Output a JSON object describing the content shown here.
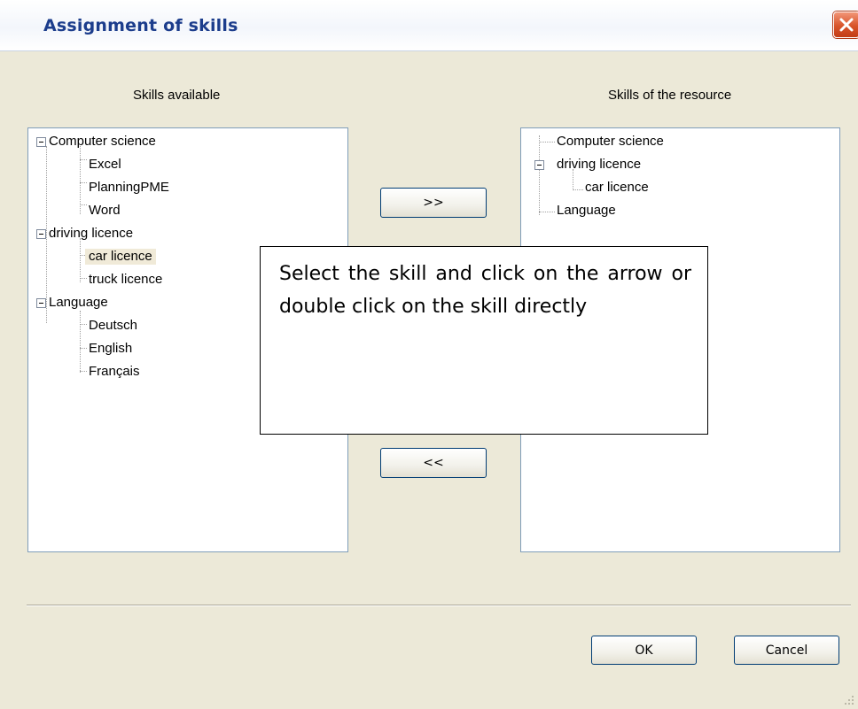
{
  "window": {
    "title": "Assignment of skills"
  },
  "left_panel": {
    "label": "Skills available",
    "tree": [
      {
        "label": "Computer science",
        "children": [
          "Excel",
          "PlanningPME",
          "Word"
        ]
      },
      {
        "label": "driving licence",
        "children": [
          "car licence",
          "truck licence"
        ]
      },
      {
        "label": "Language",
        "children": [
          "Deutsch",
          "English",
          "Français"
        ]
      }
    ],
    "selected": "car licence"
  },
  "right_panel": {
    "label": "Skills of the resource",
    "tree": [
      {
        "label": "Computer science",
        "children": []
      },
      {
        "label": "driving licence",
        "children": [
          "car licence"
        ]
      },
      {
        "label": "Language",
        "children": []
      }
    ]
  },
  "buttons": {
    "add": ">>",
    "remove": "<<",
    "ok": "OK",
    "cancel": "Cancel"
  },
  "note": "Select the skill and click on the arrow or double click on the skill directly"
}
